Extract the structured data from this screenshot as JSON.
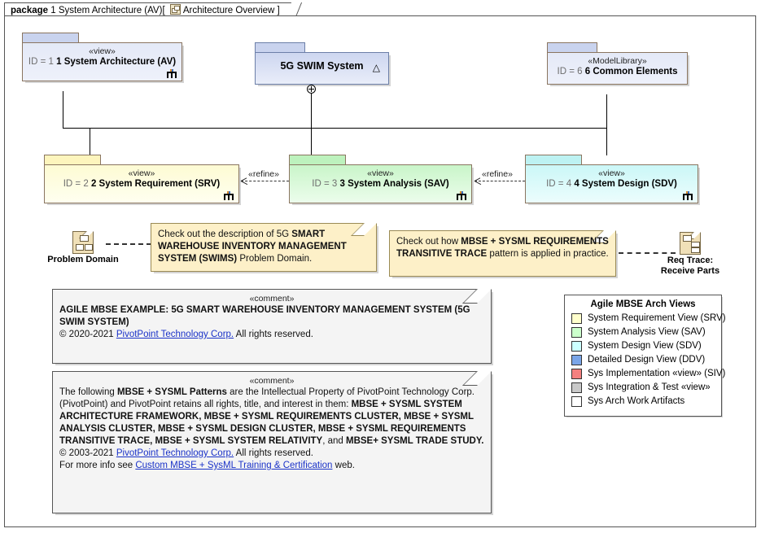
{
  "frame": {
    "keyword": "package",
    "name": "1 System Architecture (AV)",
    "open_bracket": "[",
    "diagram_icon": "diagram-icon",
    "diagram_name": "Architecture Overview",
    "close_bracket": "]"
  },
  "packages": [
    {
      "key": "sysarch",
      "stereotype": "«view»",
      "id_label": "ID = 1",
      "name": "1 System Architecture (AV)",
      "fill": "#dde3f5",
      "tab_fill": "#c9d3ee",
      "border": "#8a7560",
      "has_view_icon": true
    },
    {
      "key": "swim",
      "stereotype": "",
      "id_label": "",
      "name": "5G SWIM System",
      "fill": "#dde3f5",
      "tab_fill": "#c9d3ee",
      "border": "#6c7fa8",
      "has_view_icon": false,
      "marker": "△"
    },
    {
      "key": "modellib",
      "stereotype": "«ModelLibrary»",
      "id_label": "ID = 6",
      "name": "6 Common Elements",
      "fill": "#dde3f5",
      "tab_fill": "#c9d3ee",
      "border": "#8a7560",
      "has_view_icon": false
    },
    {
      "key": "srv",
      "stereotype": "«view»",
      "id_label": "ID = 2",
      "name": "2 System Requirement (SRV)",
      "fill": "#ffffcc",
      "tab_fill": "#fdf5bd",
      "border": "#8a7560",
      "has_view_icon": true
    },
    {
      "key": "sav",
      "stereotype": "«view»",
      "id_label": "ID = 3",
      "name": "3 System Analysis (SAV)",
      "fill": "#ccffcc",
      "tab_fill": "#bdf2bd",
      "border": "#8a7560",
      "has_view_icon": true
    },
    {
      "key": "sdv",
      "stereotype": "«view»",
      "id_label": "ID = 4",
      "name": "4 System Design (SDV)",
      "fill": "#ccffff",
      "tab_fill": "#bdf2f2",
      "border": "#8a7560",
      "has_view_icon": true
    }
  ],
  "refine_labels": {
    "sav_to_srv": "«refine»",
    "sdv_to_sav": "«refine»"
  },
  "artifacts": [
    {
      "key": "problem_domain",
      "label": "Problem Domain",
      "icon": "artifact-icon"
    },
    {
      "key": "req_trace",
      "label": "Req Trace: Receive Parts",
      "icon": "artifact-icon"
    }
  ],
  "notes": [
    {
      "key": "note_left",
      "runs": [
        {
          "t": "Check out the description of 5G ",
          "b": false
        },
        {
          "t": "SMART WAREHOUSE INVENTORY MANAGEMENT SYSTEM (SWIMS)",
          "b": true
        },
        {
          "t": " Problem Domain.",
          "b": false
        }
      ]
    },
    {
      "key": "note_right",
      "runs": [
        {
          "t": "Check out how ",
          "b": false
        },
        {
          "t": "MBSE + SYSML REQUIREMENTS TRANSITIVE TRACE",
          "b": true
        },
        {
          "t": " pattern is applied in practice.",
          "b": false
        }
      ]
    }
  ],
  "comments": [
    {
      "key": "comment_example",
      "stereotype": "«comment»",
      "runs": [
        {
          "t": "AGILE MBSE EXAMPLE:  5G SMART WAREHOUSE INVENTORY MANAGEMENT SYSTEM (5G SWIM SYSTEM)",
          "b": true
        },
        {
          "t": "\n",
          "b": false
        },
        {
          "t": "© 2020-2021 ",
          "b": false
        },
        {
          "t": "PivotPoint Technology Corp.",
          "b": false,
          "link": true
        },
        {
          "t": " All rights reserved.",
          "b": false
        }
      ]
    },
    {
      "key": "comment_ip",
      "stereotype": "«comment»",
      "runs": [
        {
          "t": "The following ",
          "b": false
        },
        {
          "t": "MBSE + SYSML Patterns",
          "b": true
        },
        {
          "t": " are the Intellectual Property of PivotPoint Technology Corp. (PivotPoint) and PivotPoint retains all rights, title, and interest in them: ",
          "b": false
        },
        {
          "t": "MBSE + SYSML SYSTEM ARCHITECTURE FRAMEWORK, MBSE + SYSML REQUIREMENTS CLUSTER, MBSE + SYSML ANALYSIS CLUSTER, MBSE + SYSML DESIGN CLUSTER, MBSE + SYSML REQUIREMENTS TRANSITIVE TRACE, MBSE + SYSML SYSTEM RELATIVITY",
          "b": true
        },
        {
          "t": ", and ",
          "b": false
        },
        {
          "t": "MBSE+ SYSML TRADE STUDY.",
          "b": true
        },
        {
          "t": "\n",
          "b": false
        },
        {
          "t": "© 2003-2021 ",
          "b": false
        },
        {
          "t": "PivotPoint Technology Corp.",
          "b": false,
          "link": true
        },
        {
          "t": " All rights reserved.",
          "b": false
        },
        {
          "t": "\n",
          "b": false
        },
        {
          "t": "For more info see ",
          "b": false
        },
        {
          "t": "Custom MBSE + SysML Training & Certification",
          "b": false,
          "link": true
        },
        {
          "t": " web.",
          "b": false
        }
      ]
    }
  ],
  "legend": {
    "title": "Agile MBSE Arch Views",
    "items": [
      {
        "label": "System Requirement View (SRV)",
        "color": "#ffffcc"
      },
      {
        "label": "System Analysis View (SAV)",
        "color": "#ccffcc"
      },
      {
        "label": "System Design View (SDV)",
        "color": "#ccffff"
      },
      {
        "label": "Detailed Design View (DDV)",
        "color": "#7aa5e8"
      },
      {
        "label": "Sys Implementation «view» (SIV)",
        "color": "#f4807f"
      },
      {
        "label": "Sys Integration & Test «view»",
        "color": "#c9c9c9"
      },
      {
        "label": "Sys Arch Work Artifacts",
        "color": "#ffffff"
      }
    ]
  }
}
